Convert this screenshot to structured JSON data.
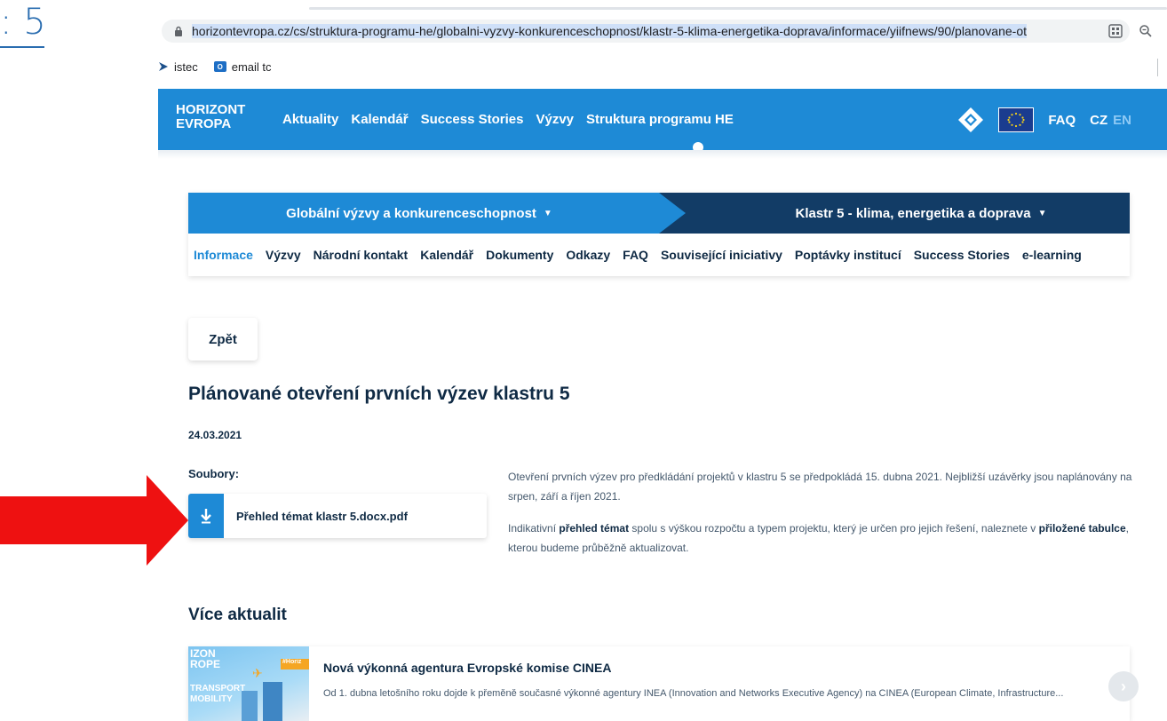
{
  "slide": {
    "number_fragment": "5"
  },
  "browser": {
    "url": "horizontevropa.cz/cs/struktura-programu-he/globalni-vyzvy-konkurenceschopnost/klastr-5-klima-energetika-doprava/informace/yiifnews/90/planovane-ot",
    "bookmarks": [
      {
        "label": "istec",
        "icon": "istec-bookmark-icon"
      },
      {
        "label": "email tc",
        "icon": "outlook-icon"
      }
    ]
  },
  "header": {
    "logo_line1": "HORIZONT",
    "logo_line2": "EVROPA",
    "nav": [
      "Aktuality",
      "Kalendář",
      "Success Stories",
      "Výzvy",
      "Struktura programu HE"
    ],
    "faq": "FAQ",
    "lang_cz": "CZ",
    "lang_en": "EN"
  },
  "breadcrumb": {
    "left": "Globální výzvy a konkurenceschopnost",
    "right": "Klastr 5 - klima, energetika a doprava"
  },
  "subnav": [
    "Informace",
    "Výzvy",
    "Národní kontakt",
    "Kalendář",
    "Dokumenty",
    "Odkazy",
    "FAQ",
    "Související iniciativy",
    "Poptávky institucí",
    "Success Stories",
    "e-learning"
  ],
  "article": {
    "back": "Zpět",
    "title": "Plánované otevření prvních výzev klastru 5",
    "date": "24.03.2021",
    "files_label": "Soubory:",
    "file_name": "Přehled témat klastr 5.docx.pdf",
    "para1": "Otevření prvních výzev pro předkládání projektů v klastru 5 se předpokládá 15. dubna 2021. Nejbližší uzávěrky jsou naplánovány na srpen, září a říjen 2021.",
    "para2_a": "Indikativní ",
    "para2_b": "přehled témat",
    "para2_c": " spolu s výškou rozpočtu a typem projektu, který je určen pro jejich řešení, naleznete v ",
    "para2_d": "přiložené tabulce",
    "para2_e": ", kterou budeme průběžně aktualizovat."
  },
  "more": {
    "title": "Více aktualit",
    "news_title": "Nová výkonná agentura Evropské komise CINEA",
    "news_desc": "Od 1. dubna letošního roku dojde k přeměně současné výkonné agentury INEA (Innovation and Networks Executive Agency) na CINEA (European Climate, Infrastructure...",
    "thumb_line1a": "IZON",
    "thumb_line1b": "ROPE",
    "thumb_line2a": "TRANSPORT",
    "thumb_line2b": "MOBILITY",
    "thumb_tag": "#Horiz"
  },
  "colors": {
    "primary_blue": "#1e8ad6",
    "dark_navy": "#123c66",
    "arrow_red": "#ee1111"
  }
}
